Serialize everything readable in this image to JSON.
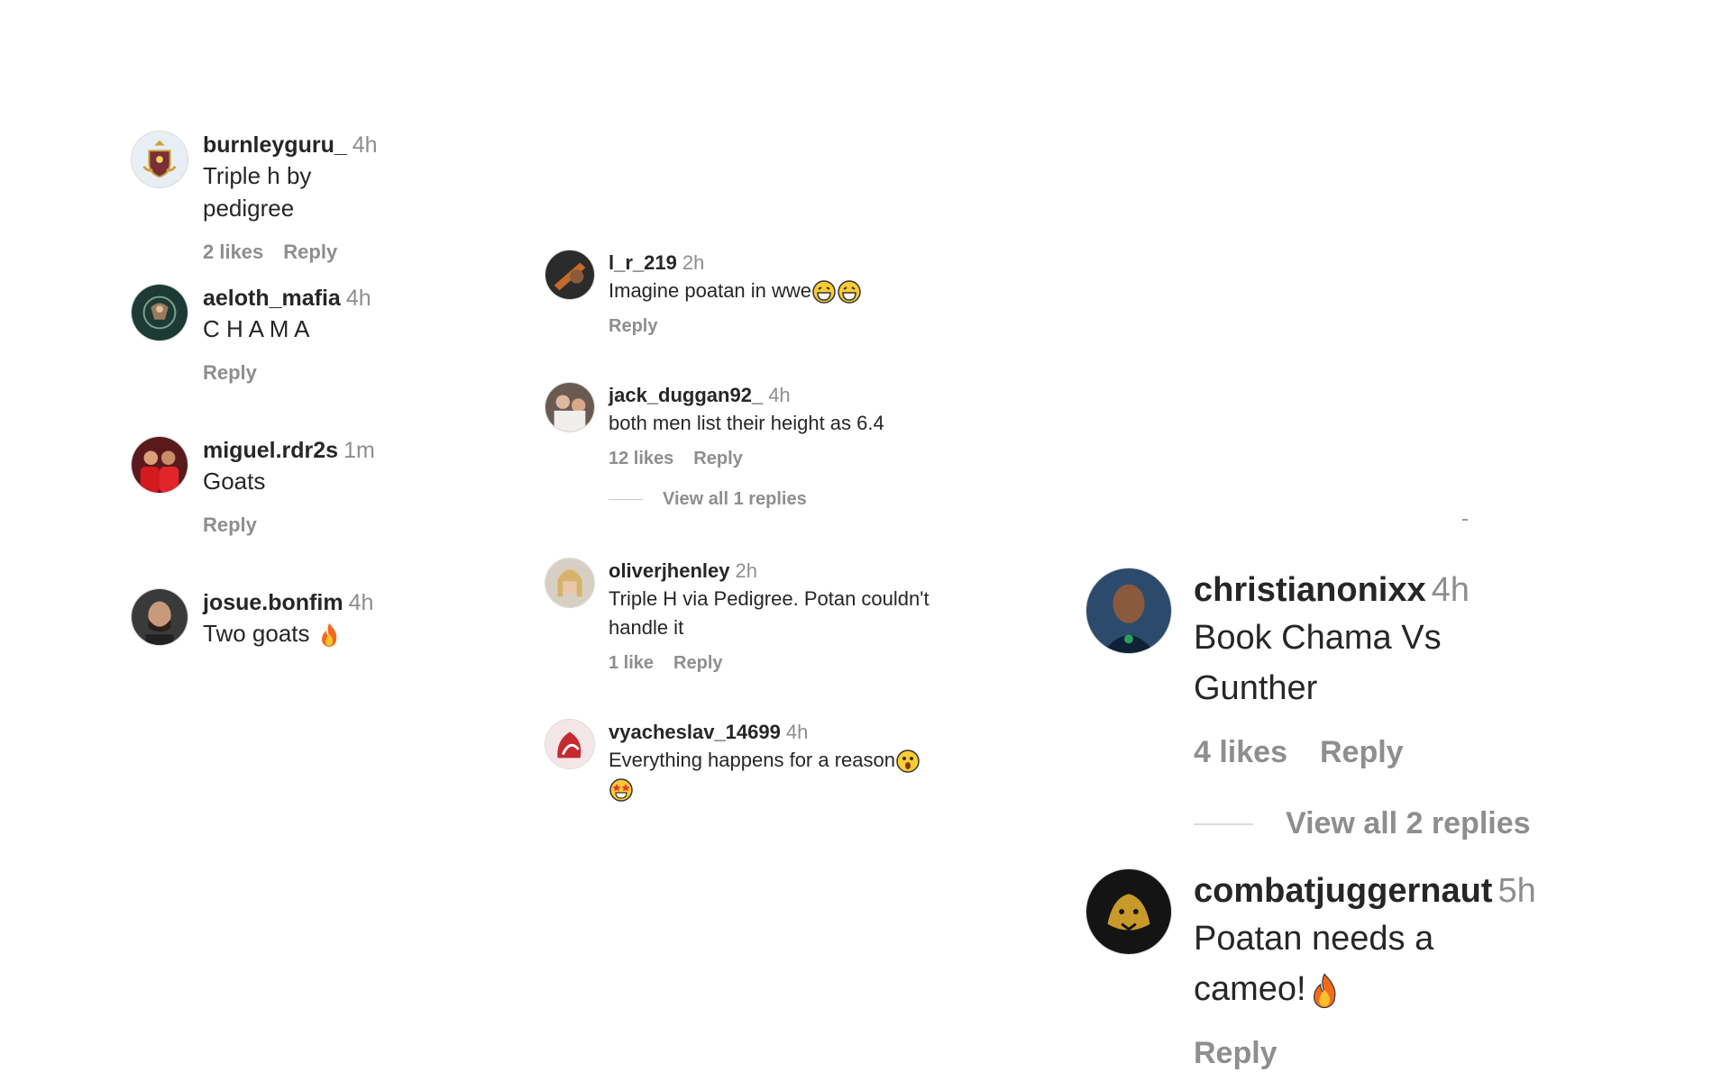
{
  "columns": {
    "left": {
      "comments": [
        {
          "user": "burnleyguru_",
          "time": "4h",
          "text": "Triple h by pedigree",
          "likes": "2 likes",
          "reply": "Reply"
        },
        {
          "user": "aeloth_mafia",
          "time": "4h",
          "text": "C H A M A",
          "reply": "Reply"
        },
        {
          "user": "miguel.rdr2s",
          "time": "1m",
          "text": "Goats",
          "reply": "Reply"
        },
        {
          "user": "josue.bonfim",
          "time": "4h",
          "text": "Two goats",
          "emoji": "fire"
        }
      ]
    },
    "middle": {
      "comments": [
        {
          "user": "l_r_219",
          "time": "2h",
          "text": "Imagine poatan in wwe",
          "emoji": "laughing x2",
          "reply": "Reply"
        },
        {
          "user": "jack_duggan92_",
          "time": "4h",
          "text": "both men list their height as 6.4",
          "likes": "12 likes",
          "reply": "Reply",
          "view_replies": "View all 1 replies"
        },
        {
          "user": "oliverjhenley",
          "time": "2h",
          "text": "Triple H via Pedigree. Potan couldn't handle it",
          "likes": "1 like",
          "reply": "Reply"
        },
        {
          "user": "vyacheslav_14699",
          "time": "4h",
          "text": "Everything happens for a reason",
          "emoji": "astonished, star-struck"
        }
      ]
    },
    "right": {
      "comments": [
        {
          "user": "christianonixx",
          "time": "4h",
          "text": "Book Chama Vs Gunther",
          "likes": "4 likes",
          "reply": "Reply",
          "view_replies": "View all 2 replies"
        },
        {
          "user": "combatjuggernaut",
          "time": "5h",
          "text": "Poatan needs a cameo!",
          "emoji": "fire",
          "reply": "Reply"
        }
      ]
    }
  },
  "colors": {
    "username": "#262626",
    "muted": "#8e8e8e",
    "background": "#ffffff"
  }
}
